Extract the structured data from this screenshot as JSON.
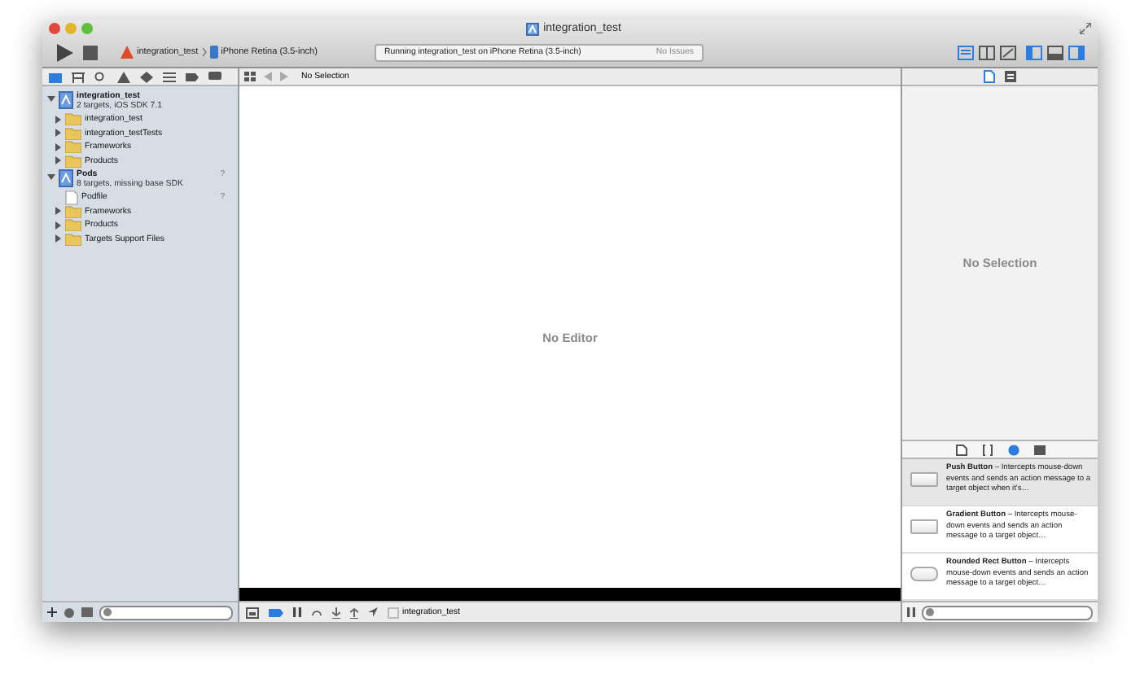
{
  "window": {
    "title": "integration_test"
  },
  "toolbar": {
    "scheme": "integration_test",
    "destination": "iPhone Retina (3.5-inch)",
    "activity": {
      "status": "Running integration_test on iPhone Retina (3.5-inch)",
      "issues": "No Issues"
    },
    "editor_modes": [
      {
        "kind": "standard",
        "selected": true
      },
      {
        "kind": "assistant",
        "selected": false
      },
      {
        "kind": "version",
        "selected": false
      }
    ],
    "view_toggles": [
      {
        "kind": "navigator",
        "on": true
      },
      {
        "kind": "debug",
        "on": false
      },
      {
        "kind": "utilities",
        "on": true
      }
    ]
  },
  "navigator": {
    "tabs": [
      {
        "kind": "folder",
        "selected": true
      },
      {
        "kind": "symbol",
        "selected": false
      },
      {
        "kind": "search",
        "selected": false
      },
      {
        "kind": "issue",
        "selected": false
      },
      {
        "kind": "test",
        "selected": false
      },
      {
        "kind": "debug",
        "selected": false
      },
      {
        "kind": "breakpoint",
        "selected": false
      },
      {
        "kind": "log",
        "selected": false
      }
    ],
    "tree": [
      {
        "kind": "project",
        "name": "integration_test",
        "subtitle": "2 targets, iOS SDK 7.1",
        "expanded": true,
        "children": [
          {
            "kind": "folder",
            "name": "integration_test",
            "expanded": false
          },
          {
            "kind": "folder",
            "name": "integration_testTests",
            "expanded": false
          },
          {
            "kind": "folder",
            "name": "Frameworks",
            "expanded": false
          },
          {
            "kind": "folder",
            "name": "Products",
            "expanded": false
          }
        ]
      },
      {
        "kind": "project",
        "name": "Pods",
        "subtitle": "8 targets, missing base SDK",
        "badge": "?",
        "expanded": true,
        "children": [
          {
            "kind": "file",
            "name": "Podfile",
            "badge": "?"
          },
          {
            "kind": "folder",
            "name": "Frameworks",
            "expanded": false
          },
          {
            "kind": "folder",
            "name": "Products",
            "expanded": false
          },
          {
            "kind": "folder",
            "name": "Targets Support Files",
            "expanded": false
          }
        ]
      }
    ]
  },
  "editor": {
    "jump_bar": "No Selection",
    "placeholder": "No Editor",
    "debug_bar": {
      "target": "integration_test"
    }
  },
  "inspector": {
    "tabs": [
      {
        "kind": "file",
        "selected": true
      },
      {
        "kind": "help",
        "selected": false
      }
    ],
    "placeholder": "No Selection"
  },
  "library": {
    "tabs": [
      {
        "kind": "file",
        "selected": false
      },
      {
        "kind": "code",
        "selected": false
      },
      {
        "kind": "object",
        "selected": true
      },
      {
        "kind": "media",
        "selected": false
      }
    ],
    "items": [
      {
        "title": "Push Button",
        "description": " – Intercepts mouse-down events and sends an action message to a target object when it's…",
        "kind": "square",
        "selected": true
      },
      {
        "title": "Gradient Button",
        "description": " – Intercepts mouse-down events and sends an action message to a target object…",
        "kind": "square",
        "selected": false
      },
      {
        "title": "Rounded Rect Button",
        "description": " – Intercepts mouse-down events and sends an action message to a target object…",
        "kind": "round",
        "selected": false
      }
    ]
  }
}
